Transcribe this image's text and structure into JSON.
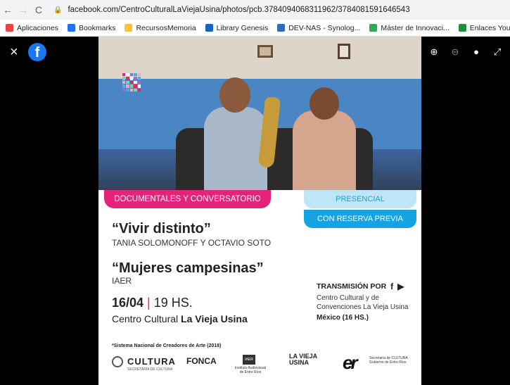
{
  "browser": {
    "url": "facebook.com/CentroCulturalLaViejaUsina/photos/pcb.3784094068311962/3784081591646543",
    "bookmarks": [
      {
        "label": "Aplicaciones",
        "icon": "apps-grid-icon",
        "color": "#e8453c"
      },
      {
        "label": "Bookmarks",
        "icon": "star-icon",
        "color": "#1a73e8"
      },
      {
        "label": "RecursosMemoria",
        "icon": "folder-icon",
        "color": "#f9c13c"
      },
      {
        "label": "Library Genesis",
        "icon": "library-icon",
        "color": "#1565c0"
      },
      {
        "label": "DEV-NAS - Synolog...",
        "icon": "synology-icon",
        "color": "#2c6db5"
      },
      {
        "label": "Máster de Innovaci...",
        "icon": "drive-icon",
        "color": "#34a853"
      },
      {
        "label": "Enlaces YouTube A...",
        "icon": "plus-icon",
        "color": "#1e8e3e"
      }
    ]
  },
  "viewer": {
    "close": "×",
    "logo": "f"
  },
  "poster": {
    "tag_pink": "DOCUMENTALES Y CONVERSATORIO",
    "tag_light": "PRESENCIAL",
    "tag_blue": "CON RESERVA PREVIA",
    "film1_title": "“Vivir distinto”",
    "film1_by": "TANIA SOLOMONOFF Y OCTAVIO SOTO",
    "film2_title": "“Mujeres campesinas”",
    "film2_by": "IAER",
    "date": "16/04",
    "date_sep": "|",
    "time": "19 HS.",
    "venue_prefix": "Centro Cultural ",
    "venue_name": "La Vieja Usina",
    "stream_label": "TRANSMISIÓN POR",
    "stream_place": "Centro Cultural y de Convenciones La Vieja Usina",
    "stream_time": "México (16 HS.)",
    "footnote": "*Sistema Nacional de Creadores de Arte (2018)",
    "logo_cultura": "CULTURA",
    "logo_cultura_sub": "SECRETARÍA DE CULTURA",
    "logo_fonca": "FONCA",
    "logo_iaer": "IAER",
    "logo_iaer_sub": "Instituto Audiovisual de Entre Ríos",
    "logo_vieja": "LA VIEJA USINA",
    "logo_er": "er",
    "logo_er_sub": "Secretaría de CULTURA Gobierno de Entre Ríos"
  }
}
